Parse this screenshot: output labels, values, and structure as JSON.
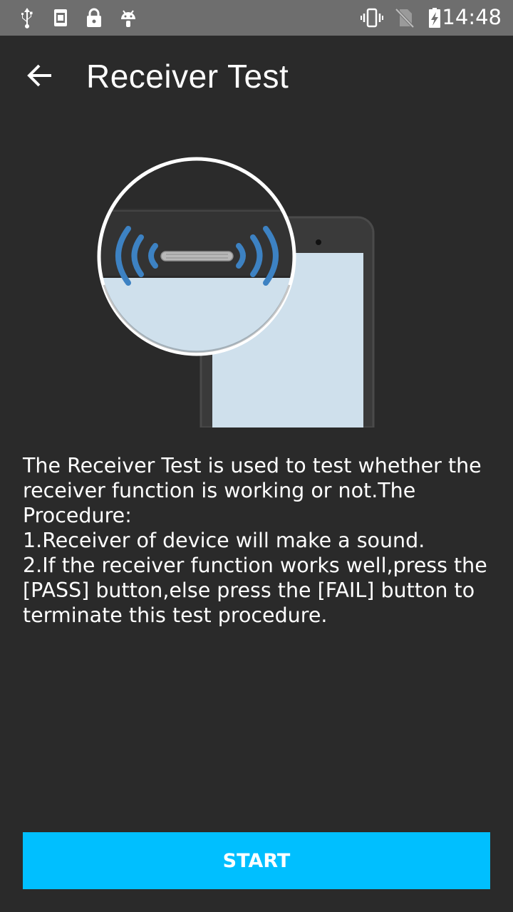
{
  "status_bar": {
    "time": "14:48",
    "icons_left": [
      "usb-icon",
      "screenshot-notification-icon",
      "lock-icon",
      "android-debug-icon"
    ],
    "icons_right": [
      "vibrate-icon",
      "no-sim-icon",
      "battery-charging-icon"
    ]
  },
  "app_bar": {
    "back_icon": "arrow-back-icon",
    "title": "Receiver Test"
  },
  "illustration": {
    "subject": "phone-receiver-magnified",
    "wave_color": "#3d82c3",
    "screen_color": "#cfe0ec"
  },
  "description": {
    "lines": [
      "The Receiver Test is used to test whether the receiver function is working or not.The Procedure:",
      "1.Receiver of device will make a sound.",
      "2.If the receiver function works well,press the [PASS] button,else press the [FAIL] button to terminate this test procedure."
    ]
  },
  "actions": {
    "start_label": "START"
  },
  "colors": {
    "background": "#2a2a2a",
    "status_bar": "#6e6e6e",
    "accent": "#00bfff"
  }
}
